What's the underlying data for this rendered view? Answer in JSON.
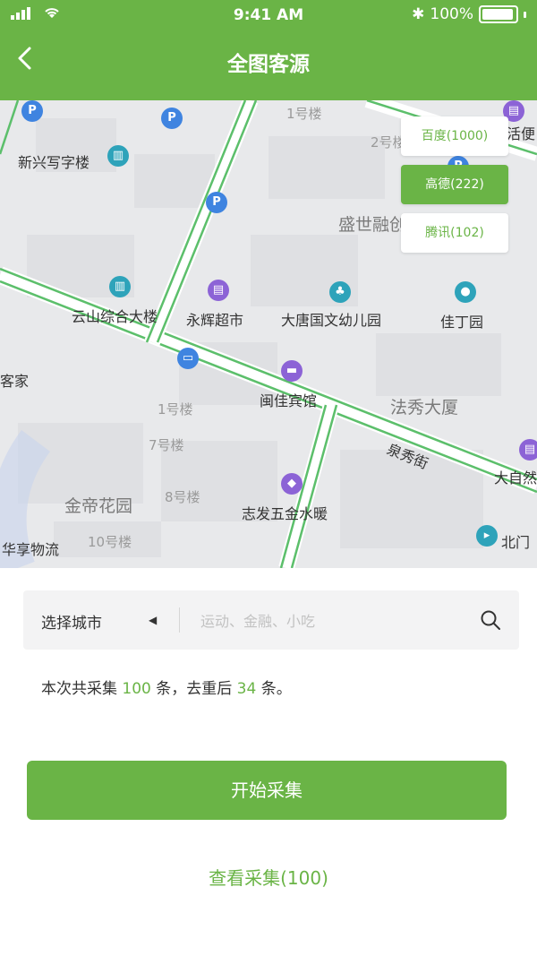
{
  "status_bar": {
    "time": "9:41 AM",
    "battery": "100%"
  },
  "header": {
    "title": "全图客源",
    "back_icon": "chevron-left-icon"
  },
  "map": {
    "labels": {
      "xinxing": "新兴写字楼",
      "yunshan": "云山综合大楼",
      "yonghui": "永辉超市",
      "datang": "大唐国文幼儿园",
      "jiading": "佳丁园",
      "minjia": "闽佳宾馆",
      "shengshi": "盛世融创",
      "faxiu": "法秀大厦",
      "jindi": "金帝花园",
      "zhifa": "志发五金水暖",
      "huaxiang": "华享物流",
      "huojia": "客家",
      "bldg1_top": "1号楼",
      "bldg2_top": "2号楼",
      "bldg1": "1号楼",
      "bldg7": "7号楼",
      "bldg8": "8号楼",
      "bldg10": "10号楼",
      "quanxiu": "泉秀街",
      "daziran": "大自然",
      "beimen": "北门",
      "huobian": "活便"
    }
  },
  "sources": [
    {
      "label": "百度(1000)",
      "active": false
    },
    {
      "label": "高德(222)",
      "active": true
    },
    {
      "label": "腾讯(102)",
      "active": false
    }
  ],
  "search": {
    "city_label": "选择城市",
    "placeholder": "运动、金融、小吃",
    "value": ""
  },
  "summary": {
    "prefix": "本次共采集 ",
    "collected": "100",
    "middle": " 条，去重后 ",
    "dedup": "34",
    "suffix": " 条。"
  },
  "actions": {
    "start_label": "开始采集",
    "view_label": "查看采集(100)"
  },
  "colors": {
    "brand": "#6ab446",
    "road": "#5cbf6b"
  }
}
